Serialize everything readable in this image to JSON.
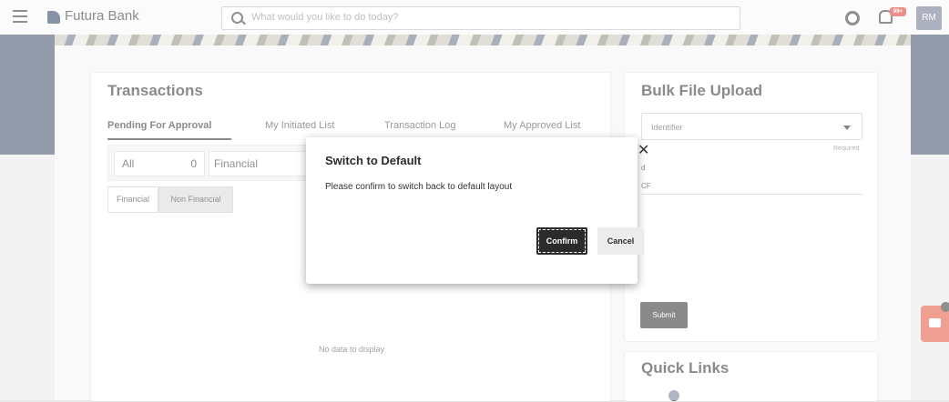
{
  "header": {
    "brand": "Futura Bank",
    "search_placeholder": "What would you like to do today?",
    "notification_badge": "99+",
    "avatar_initials": "RM"
  },
  "transactions": {
    "title": "Transactions",
    "tabs": [
      "Pending For Approval",
      "My Initiated List",
      "Transaction Log",
      "My Approved List"
    ],
    "filter_all_label": "All",
    "filter_all_count": "0",
    "filter_category": "Financial",
    "segments": [
      "Financial",
      "Non Financial"
    ],
    "empty_message": "No data to display"
  },
  "bulk_upload": {
    "title": "Bulk File Upload",
    "select_value": "Identifier",
    "required_label": "Required",
    "field_label": "d",
    "field_value": "CF",
    "submit_label": "Submit"
  },
  "quick_links": {
    "title": "Quick Links"
  },
  "modal": {
    "title": "Switch to Default",
    "message": "Please confirm to switch back to default layout",
    "confirm_label": "Confirm",
    "cancel_label": "Cancel",
    "close_glyph": "✕"
  },
  "colors": {
    "banner": "#3d4964",
    "primary_button": "#2b2b2b",
    "chat_accent": "#e3523a",
    "badge": "#d9342b"
  }
}
